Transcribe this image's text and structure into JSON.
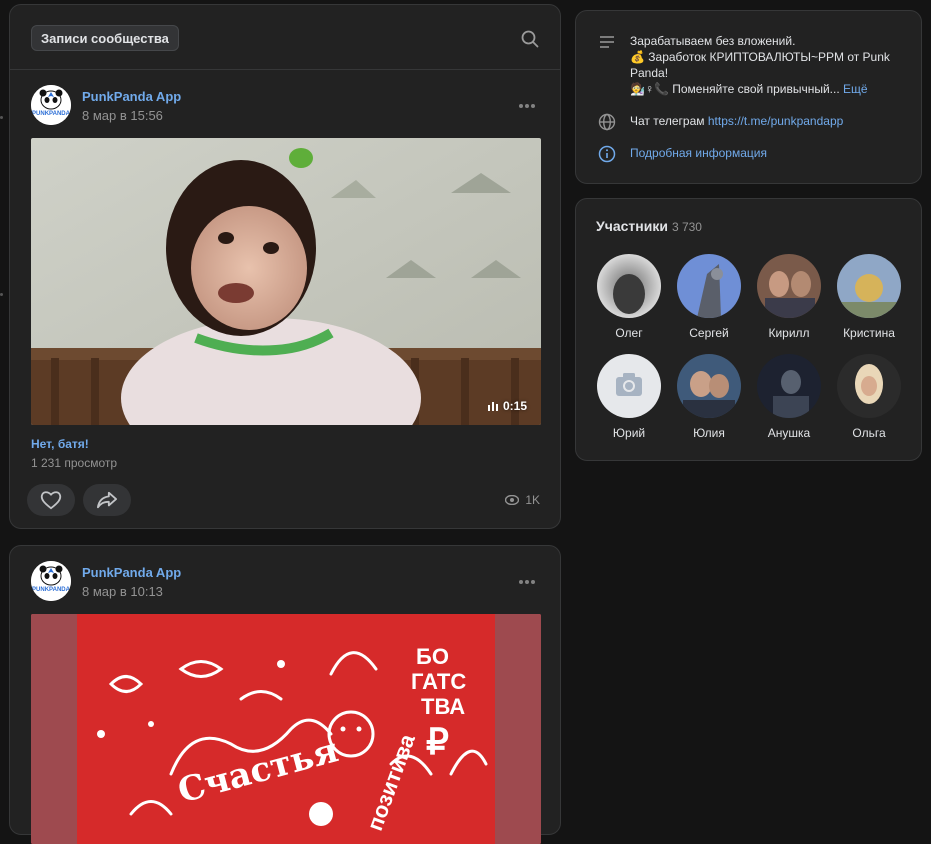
{
  "feed": {
    "tab_label": "Записи сообщества",
    "search_icon": "search-icon"
  },
  "posts": [
    {
      "author": "PunkPanda App",
      "date": "8 мар в 15:56",
      "video": {
        "duration": "0:15",
        "title": "Нет, батя!",
        "views": "1 231 просмотр"
      },
      "view_count": "1K"
    },
    {
      "author": "PunkPanda App",
      "date": "8 мар в 10:13"
    }
  ],
  "info": {
    "description_lines": [
      "Зарабатываем без вложений.",
      "💰 Заработок КРИПТОВАЛЮТЫ~PPM от Punk Panda!",
      "🧑‍🔬♀📞 Поменяйте свой привычный..."
    ],
    "more_label": "Ещё",
    "telegram_label": "Чат телеграм",
    "telegram_link": "https://t.me/punkpandapp",
    "details_label": "Подробная информация"
  },
  "members": {
    "title": "Участники",
    "count": "3 730",
    "list": [
      {
        "name": "Олег"
      },
      {
        "name": "Сергей"
      },
      {
        "name": "Кирилл"
      },
      {
        "name": "Кристина"
      },
      {
        "name": "Юрий"
      },
      {
        "name": "Юлия"
      },
      {
        "name": "Анушка"
      },
      {
        "name": "Ольга"
      }
    ]
  },
  "colors": {
    "background": "#141414",
    "card": "#222222",
    "accent_link": "#71aaeb"
  }
}
